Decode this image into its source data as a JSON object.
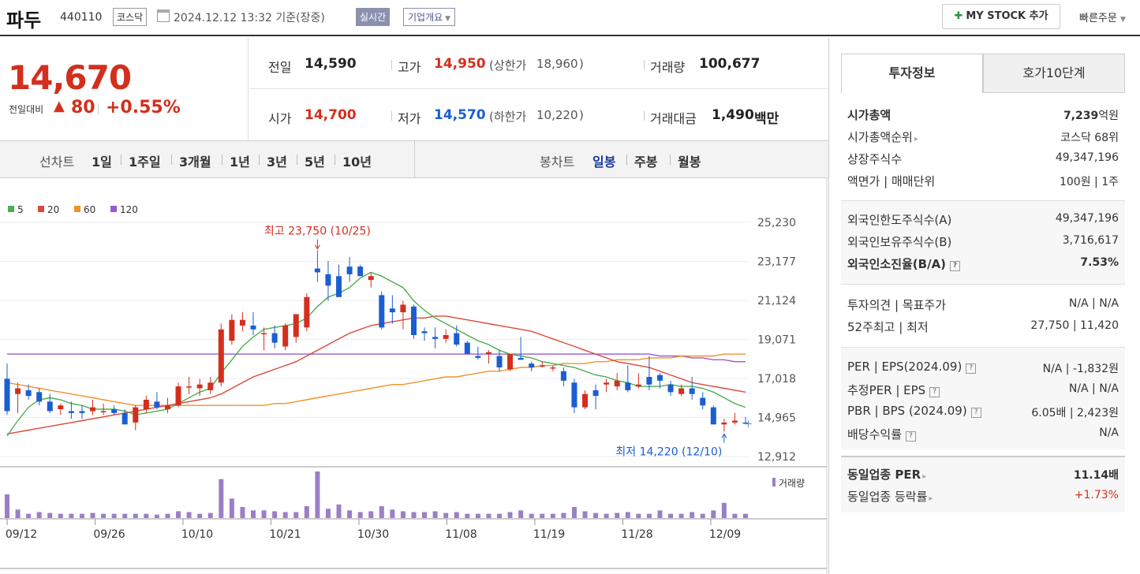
{
  "header": {
    "name": "파두",
    "code": "440110",
    "market": "코스닥",
    "datetime": "2024.12.12 13:32  기준(장중)",
    "realtime": "실시간",
    "corp_info": "기업개요",
    "mystock": "MY STOCK 추가",
    "quick_order": "빠른주문"
  },
  "price": {
    "current": "14,670",
    "change_label": "전일대비",
    "change_arrow": "▲",
    "change": "80",
    "change_pct": "+0.55%"
  },
  "stats": {
    "prev_label": "전일",
    "prev": "14,590",
    "high_label": "고가",
    "high": "14,950",
    "upper_label": "(상한가",
    "upper": "18,960",
    "upper_close": ")",
    "volume_label": "거래량",
    "volume": "100,677",
    "open_label": "시가",
    "open": "14,700",
    "low_label": "저가",
    "low": "14,570",
    "lower_label": "(하한가",
    "lower": "10,220",
    "lower_close": ")",
    "amount_label": "거래대금",
    "amount": "1,490",
    "amount_unit": "백만"
  },
  "tabs": {
    "line_chart": "선차트",
    "periods": [
      "1일",
      "1주일",
      "3개월",
      "1년",
      "3년",
      "5년",
      "10년"
    ],
    "candle_chart": "봉차트",
    "candle_periods": [
      "일봉",
      "주봉",
      "월봉"
    ]
  },
  "right": {
    "tab_invest": "투자정보",
    "tab_orderbook": "호가10단계",
    "market_cap_label": "시가총액",
    "market_cap": "7,239",
    "market_cap_unit": "억원",
    "rank_label": "시가총액순위",
    "rank": "코스닥 68위",
    "shares_label": "상장주식수",
    "shares": "49,347,196",
    "par_label": "액면가 | 매매단위",
    "par": "100원 | 1주",
    "foreign_limit_label": "외국인한도주식수(A)",
    "foreign_limit": "49,347,196",
    "foreign_hold_label": "외국인보유주식수(B)",
    "foreign_hold": "3,716,617",
    "foreign_ratio_label": "외국인소진율(B/A)",
    "foreign_ratio": "7.53%",
    "opinion_label": "투자의견 | 목표주가",
    "opinion": "N/A | N/A",
    "w52_label": "52주최고 | 최저",
    "w52": "27,750 | 11,420",
    "per_label": "PER | EPS(2024.09)",
    "per": "N/A | -1,832원",
    "est_per_label": "추정PER | EPS",
    "est_per": "N/A | N/A",
    "pbr_label": "PBR | BPS (2024.09)",
    "pbr": "6.05배 | 2,423원",
    "div_label": "배당수익률",
    "div": "N/A",
    "ind_per_label": "동일업종 PER",
    "ind_per": "11.14배",
    "ind_chg_label": "동일업종 등락률",
    "ind_chg": "+1.73%"
  },
  "colors": {
    "up": "#d32f1e",
    "down": "#1a5ed1",
    "ma5": "#4caf50",
    "ma20": "#d94a3a",
    "ma60": "#f0922a",
    "ma120": "#9b59d0",
    "volume": "#9b7ec8"
  },
  "chart_data": {
    "type": "candlestick",
    "legend": [
      "5",
      "20",
      "60",
      "120"
    ],
    "y_ticks": [
      "25,230",
      "23,177",
      "21,124",
      "19,071",
      "17,018",
      "14,965",
      "12,912"
    ],
    "ylim": [
      12912,
      25230
    ],
    "x_ticks": [
      "09/12",
      "09/26",
      "10/10",
      "10/21",
      "10/30",
      "11/08",
      "11/19",
      "11/28",
      "12/09"
    ],
    "high_annotation": "최고 23,750 (10/25)",
    "low_annotation": "최저 14,220 (12/10)",
    "volume_label": "거래량",
    "candles": [
      [
        17000,
        17800,
        15100,
        15300
      ],
      [
        16200,
        16800,
        15200,
        16500
      ],
      [
        16400,
        16700,
        15900,
        16100
      ],
      [
        16300,
        16500,
        15600,
        15800
      ],
      [
        15800,
        16200,
        15200,
        15300
      ],
      [
        15400,
        15700,
        15100,
        15600
      ],
      [
        15300,
        15800,
        14900,
        15200
      ],
      [
        15300,
        15600,
        14900,
        15200
      ],
      [
        15300,
        15900,
        15100,
        15500
      ],
      [
        15300,
        15700,
        15100,
        15300
      ],
      [
        15400,
        15600,
        15100,
        15200
      ],
      [
        15200,
        15400,
        14600,
        14600
      ],
      [
        14700,
        15600,
        14300,
        15500
      ],
      [
        15400,
        16100,
        15200,
        15900
      ],
      [
        15800,
        16300,
        15400,
        15500
      ],
      [
        15400,
        16000,
        15200,
        15600
      ],
      [
        15600,
        16800,
        15500,
        16600
      ],
      [
        16600,
        17100,
        16200,
        16600
      ],
      [
        16500,
        17000,
        16100,
        16700
      ],
      [
        16400,
        17100,
        16200,
        16800
      ],
      [
        16800,
        19900,
        16600,
        19600
      ],
      [
        19000,
        20400,
        18800,
        20100
      ],
      [
        19800,
        20500,
        19500,
        20100
      ],
      [
        19800,
        20500,
        19300,
        19600
      ],
      [
        19400,
        19700,
        18500,
        19400
      ],
      [
        19400,
        19800,
        18600,
        18900
      ],
      [
        18700,
        19900,
        18500,
        19800
      ],
      [
        19200,
        20400,
        18900,
        20400
      ],
      [
        19700,
        21500,
        19500,
        21300
      ],
      [
        22800,
        23750,
        22100,
        22600
      ],
      [
        22500,
        23200,
        21100,
        21900
      ],
      [
        22400,
        23000,
        21300,
        21300
      ],
      [
        22900,
        23400,
        22100,
        22500
      ],
      [
        22900,
        23000,
        22400,
        22400
      ],
      [
        22200,
        22600,
        21800,
        22400
      ],
      [
        21400,
        21600,
        19600,
        19700
      ],
      [
        20700,
        21400,
        19900,
        20500
      ],
      [
        20500,
        21100,
        19600,
        20900
      ],
      [
        20800,
        20900,
        19100,
        19300
      ],
      [
        19500,
        19700,
        19000,
        19400
      ],
      [
        19200,
        19700,
        18600,
        19100
      ],
      [
        19100,
        19600,
        18900,
        19300
      ],
      [
        19400,
        19800,
        18700,
        18800
      ],
      [
        18900,
        19000,
        18300,
        18300
      ],
      [
        18200,
        18700,
        18000,
        18100
      ],
      [
        18300,
        18500,
        17800,
        18400
      ],
      [
        18200,
        18500,
        17400,
        17600
      ],
      [
        17500,
        18300,
        17400,
        18300
      ],
      [
        18100,
        19200,
        18000,
        18000
      ],
      [
        17800,
        17900,
        17400,
        17600
      ],
      [
        17700,
        17900,
        17600,
        17700
      ],
      [
        17600,
        17700,
        17400,
        17600
      ],
      [
        17400,
        17600,
        16600,
        16900
      ],
      [
        16800,
        17000,
        15200,
        15500
      ],
      [
        15500,
        16400,
        15400,
        16200
      ],
      [
        16400,
        16700,
        15400,
        16100
      ],
      [
        16700,
        17000,
        16300,
        16800
      ],
      [
        16600,
        17300,
        16400,
        16900
      ],
      [
        16800,
        17700,
        16300,
        16400
      ],
      [
        16600,
        17300,
        16500,
        16700
      ],
      [
        17100,
        18200,
        16400,
        16700
      ],
      [
        17200,
        17300,
        16500,
        16900
      ],
      [
        16700,
        16900,
        16100,
        16300
      ],
      [
        16200,
        16700,
        16100,
        16500
      ],
      [
        16500,
        17100,
        15900,
        16200
      ],
      [
        16000,
        16300,
        15400,
        15600
      ],
      [
        15500,
        15600,
        14600,
        14600
      ],
      [
        14600,
        14900,
        14220,
        14700
      ],
      [
        14700,
        15200,
        14600,
        14800
      ],
      [
        14700,
        15000,
        14600,
        14670
      ]
    ],
    "volumes": [
      28,
      10,
      5,
      7,
      6,
      5,
      5,
      5,
      6,
      5,
      5,
      5,
      5,
      5,
      4,
      5,
      8,
      7,
      5,
      6,
      46,
      23,
      13,
      9,
      9,
      8,
      7,
      7,
      14,
      55,
      11,
      16,
      9,
      7,
      8,
      14,
      10,
      8,
      7,
      7,
      8,
      6,
      7,
      5,
      5,
      5,
      5,
      7,
      9,
      5,
      5,
      5,
      6,
      13,
      8,
      6,
      5,
      6,
      7,
      5,
      5,
      9,
      5,
      5,
      7,
      5,
      9,
      18,
      5,
      5
    ],
    "ma5": [
      14000,
      14800,
      15500,
      15900,
      16000,
      15900,
      15700,
      15600,
      15400,
      15400,
      15400,
      15300,
      15100,
      15200,
      15300,
      15400,
      15700,
      16000,
      16300,
      16500,
      17300,
      18000,
      18700,
      19200,
      19600,
      19700,
      19800,
      19900,
      20200,
      20800,
      21300,
      21500,
      21800,
      22300,
      22600,
      22400,
      22100,
      21800,
      21100,
      20600,
      20200,
      19900,
      19600,
      19300,
      19000,
      18800,
      18500,
      18300,
      18200,
      18100,
      17900,
      17800,
      17700,
      17600,
      17400,
      17200,
      17100,
      16900,
      16800,
      16600,
      16600,
      16600,
      16700,
      16600,
      16600,
      16500,
      16300,
      16000,
      15700,
      15500
    ],
    "ma20": [
      14100,
      14200,
      14300,
      14400,
      14500,
      14600,
      14700,
      14800,
      14900,
      15000,
      15100,
      15200,
      15300,
      15400,
      15500,
      15600,
      15700,
      15800,
      15900,
      16000,
      16200,
      16500,
      16800,
      17100,
      17300,
      17500,
      17700,
      17900,
      18200,
      18500,
      18800,
      19100,
      19400,
      19600,
      19800,
      19900,
      20000,
      20100,
      20200,
      20200,
      20300,
      20300,
      20200,
      20100,
      20000,
      19900,
      19800,
      19700,
      19600,
      19500,
      19300,
      19100,
      18900,
      18700,
      18500,
      18300,
      18100,
      17900,
      17800,
      17700,
      17600,
      17400,
      17200,
      17000,
      16800,
      16700,
      16600,
      16500,
      16400,
      16300
    ],
    "ma60": [
      16800,
      16700,
      16600,
      16500,
      16400,
      16300,
      16200,
      16100,
      16000,
      15900,
      15800,
      15700,
      15600,
      15600,
      15600,
      15600,
      15600,
      15600,
      15600,
      15600,
      15600,
      15600,
      15600,
      15600,
      15600,
      15700,
      15700,
      15800,
      15900,
      16000,
      16100,
      16200,
      16300,
      16400,
      16500,
      16600,
      16700,
      16700,
      16800,
      16900,
      17000,
      17100,
      17100,
      17200,
      17300,
      17400,
      17400,
      17500,
      17600,
      17600,
      17700,
      17700,
      17800,
      17800,
      17800,
      17900,
      17900,
      18000,
      18000,
      18000,
      18100,
      18100,
      18100,
      18200,
      18200,
      18200,
      18200,
      18300,
      18300,
      18300
    ],
    "ma120": [
      18300,
      18300,
      18300,
      18300,
      18300,
      18300,
      18300,
      18300,
      18300,
      18300,
      18300,
      18300,
      18300,
      18300,
      18300,
      18300,
      18300,
      18300,
      18300,
      18300,
      18300,
      18300,
      18300,
      18300,
      18300,
      18300,
      18300,
      18300,
      18300,
      18300,
      18300,
      18300,
      18300,
      18300,
      18300,
      18300,
      18300,
      18300,
      18300,
      18300,
      18300,
      18300,
      18300,
      18300,
      18300,
      18300,
      18300,
      18300,
      18300,
      18300,
      18300,
      18300,
      18300,
      18300,
      18300,
      18300,
      18300,
      18300,
      18300,
      18300,
      18300,
      18200,
      18200,
      18200,
      18100,
      18100,
      18000,
      18000,
      17900,
      17900
    ]
  }
}
